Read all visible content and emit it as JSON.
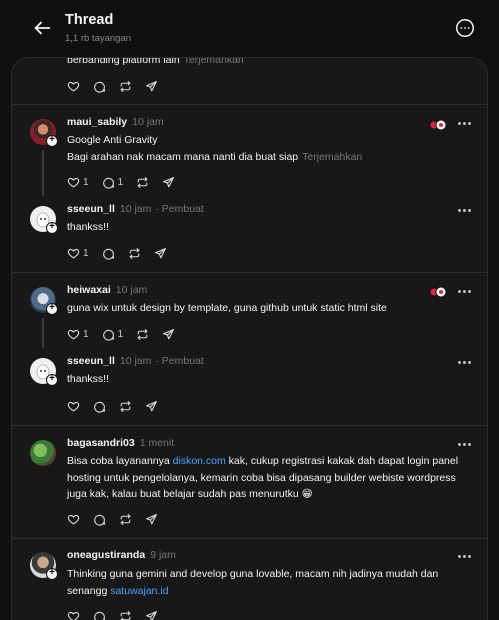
{
  "header": {
    "title": "Thread",
    "views": "1,1 rb tayangan"
  },
  "top_post": {
    "text": "berbanding platform lain",
    "translate": "Terjemahkan"
  },
  "posts": [
    {
      "username": "maui_sabily",
      "time": "10 jam",
      "line1": "Google Anti Gravity",
      "line2": "Bagi arahan nak macam mana nanti dia buat siap",
      "translate": "Terjemahkan",
      "likes": "1",
      "replies": "1"
    },
    {
      "username": "sseeun_ll",
      "time": "10 jam",
      "author_tag": "· Pembuat",
      "text": "thankss!!",
      "likes": "1"
    },
    {
      "username": "heiwaxai",
      "time": "10 jam",
      "text": "guna wix untuk design by template, guna github untuk static html site",
      "likes": "1",
      "replies": "1"
    },
    {
      "username": "sseeun_ll",
      "time": "10 jam",
      "author_tag": "· Pembuat",
      "text": "thankss!!"
    },
    {
      "username": "bagasandri03",
      "time": "1 menit",
      "text_before_link": "Bisa coba layanannya ",
      "link": "diskon.com",
      "text_after_link": " kak, cukup registrasi kakak dah dapat login panel hosting untuk pengelolanya, kemarin coba bisa dipasang builder webiste wordpress juga kak, kalau buat belajar sudah pas menurutku 😁"
    },
    {
      "username": "oneagustiranda",
      "time": "9 jam",
      "text_before_link": "Thinking guna gemini and develop guna lovable, macam nih jadinya mudah dan senangg ",
      "link": "satuwajan.id"
    }
  ],
  "colors": {
    "background": "#101010",
    "card": "#181818",
    "border": "#2d2d2d",
    "link": "#4aa3ff",
    "muted": "#777777",
    "reaction_red": "#e0243c"
  },
  "icons": [
    "back-arrow-icon",
    "more-circle-icon",
    "heart-icon",
    "comment-icon",
    "repost-icon",
    "share-icon",
    "more-dots-icon"
  ]
}
